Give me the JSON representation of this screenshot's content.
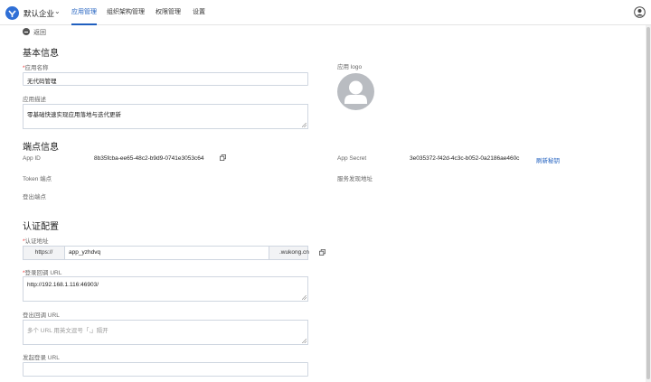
{
  "header": {
    "org_name": "默认企业",
    "tabs": [
      {
        "label": "应用管理",
        "active": true
      },
      {
        "label": "组织架构管理",
        "active": false
      },
      {
        "label": "权限管理",
        "active": false
      },
      {
        "label": "设置",
        "active": false
      }
    ]
  },
  "back_label": "返回",
  "basic": {
    "title": "基本信息",
    "app_name_label": "应用名称",
    "app_name_value": "无代码管理",
    "app_desc_label": "应用描述",
    "app_desc_value": "零基础快速实现应用落地与迭代更新",
    "logo_label": "应用 logo"
  },
  "endpoints": {
    "title": "端点信息",
    "app_id_label": "App ID",
    "app_id_value": "8b35fcba-ee65-48c2-b9d9-0741e3053c64",
    "app_secret_label": "App Secret",
    "app_secret_value": "3e035372-f42d-4c3c-b052-0a2186ae460c",
    "refresh_secret_label": "刷新秘钥",
    "token_label": "Token 端点",
    "discovery_label": "服务发现地址",
    "logout_label": "登出端点"
  },
  "auth": {
    "title": "认证配置",
    "auth_url_label": "认证地址",
    "url_prefix": "https://",
    "url_value": "app_yzhdvq",
    "url_suffix": ".wukong.cn",
    "callback_label": "登录回调 URL",
    "callback_value": "http://192.168.1.116:46903/",
    "logout_callback_label": "登出回调 URL",
    "logout_callback_placeholder": "多个 URL 用英文逗号「,」隔开",
    "initiate_login_label": "发起登录 URL",
    "initiate_login_value": ""
  },
  "colors": {
    "accent": "#1f5fbf",
    "required": "#e33333",
    "avatar_bg": "#b9bcc1"
  }
}
